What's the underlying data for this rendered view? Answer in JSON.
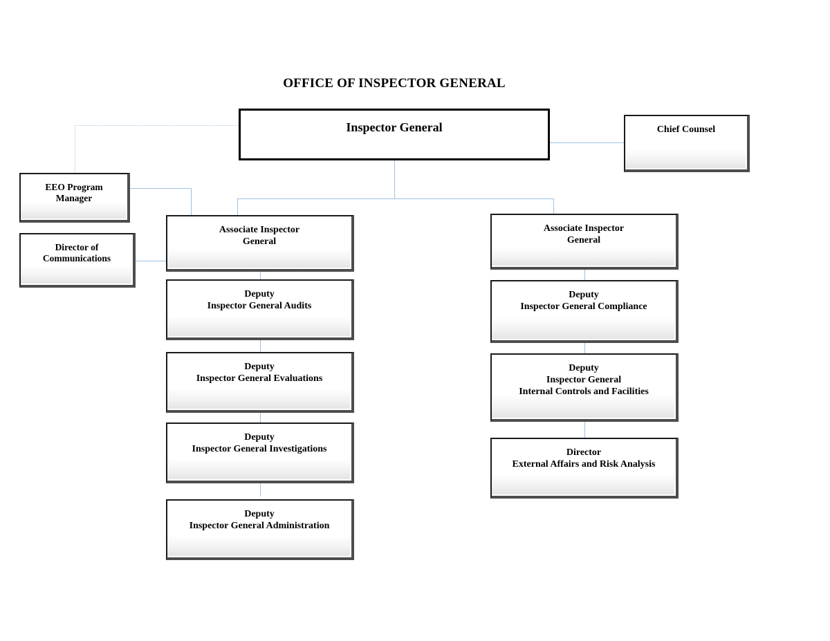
{
  "chart": {
    "title": "OFFICE OF INSPECTOR GENERAL",
    "type": "organizational-chart",
    "connector_color": "#9ec0e4",
    "dotted_connector_color": "#aecbe8",
    "box_border_color": "#1a1a1a",
    "background_color": "#ffffff"
  },
  "nodes": {
    "inspector_general": {
      "label": "Inspector General"
    },
    "chief_counsel": {
      "label": "Chief Counsel"
    },
    "eeo_program_manager": {
      "label": "EEO Program\nManager"
    },
    "director_of_communications": {
      "label": "Director of\nCommunications"
    },
    "associate_ig_left": {
      "label": "Associate Inspector\nGeneral"
    },
    "associate_ig_right": {
      "label": "Associate Inspector\nGeneral"
    },
    "deputy_audits": {
      "label": "Deputy\nInspector General Audits"
    },
    "deputy_evaluations": {
      "label": "Deputy\nInspector General Evaluations"
    },
    "deputy_investigations": {
      "label": "Deputy\nInspector General Investigations"
    },
    "deputy_administration": {
      "label": "Deputy\nInspector General Administration"
    },
    "deputy_compliance": {
      "label": "Deputy\nInspector General Compliance"
    },
    "deputy_internal_controls": {
      "label": "Deputy\nInspector General\nInternal Controls and Facilities"
    },
    "director_external_affairs": {
      "label": "Director\nExternal Affairs and Risk Analysis"
    }
  }
}
